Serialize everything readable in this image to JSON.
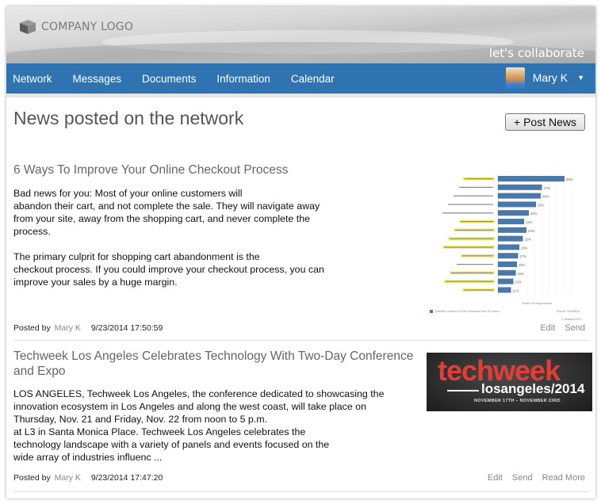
{
  "header": {
    "logo_text": "COMPANY LOGO",
    "logo_icon": "cube-icon",
    "tagline": "let's collaborate"
  },
  "nav": {
    "items": [
      {
        "label": "Network"
      },
      {
        "label": "Messages"
      },
      {
        "label": "Documents"
      },
      {
        "label": "Information"
      },
      {
        "label": "Calendar"
      }
    ],
    "user": {
      "name": "Mary K",
      "avatar": "user-avatar",
      "menu_icon": "caret-down-icon"
    }
  },
  "main": {
    "title": "News posted on the network",
    "post_button": "+ Post News",
    "articles": [
      {
        "title": "6 Ways To Improve Your Online Checkout Process",
        "body": "Bad news for you:  Most of your online customers will\nabandon their cart, and not complete the sale. They will navigate away\nfrom your site, away from the shopping cart, and never complete the\nprocess.\n\nThe primary culprit for shopping cart abandonment is the\ncheckout process. If you could improve your checkout process, you can\nimprove your sales by a huge margin.",
        "posted_by_label": "Posted by",
        "author": "Mary K",
        "date": "9/23/2014 17:50:59",
        "actions": [
          "Edit",
          "Send"
        ],
        "image": "shopping-cart-abandonment-chart"
      },
      {
        "title": "Techweek Los Angeles Celebrates Technology With Two-Day Conference and Expo",
        "body": "LOS ANGELES, Techweek Los Angeles, the conference dedicated to showcasing the\ninnovation ecosystem in Los Angeles and along the west coast, will take place on\nThursday, Nov. 21 and Friday, Nov. 22 from noon to 5 p.m.\nat L3 in Santa Monica Place.  Techweek Los Angeles celebrates the\ntechnology landscape with a variety of panels and events focused on the\nwide array of industries influenc ...",
        "posted_by_label": "Posted by",
        "author": "Mary K",
        "date": "9/23/2014 17:47:20",
        "actions": [
          "Edit",
          "Send",
          "Read More"
        ],
        "image": {
          "brand": "techweek",
          "city": "losangeles/2014",
          "dates": "NOVEMBER 17TH – NOVEMBER 23RD"
        }
      }
    ]
  },
  "chart_data": {
    "type": "bar",
    "orientation": "horizontal",
    "title": "",
    "xlabel": "Share of respondents",
    "categories": [
      "r1",
      "r2",
      "r3",
      "r4",
      "r5",
      "r6",
      "r7",
      "r8",
      "r9",
      "r10",
      "r11",
      "r12",
      "r13",
      "r14"
    ],
    "values": [
      56,
      37,
      36,
      32,
      26,
      22,
      24,
      21,
      18,
      17,
      16,
      15,
      13,
      11
    ],
    "unit": "%",
    "highlighted": [
      true,
      false,
      false,
      false,
      false,
      true,
      true,
      true,
      true,
      true,
      false,
      true,
      true,
      true
    ],
    "colors": {
      "bar": "#4a78a8",
      "highlight": "#f5ec6a"
    },
    "source": "Source: WorldPay",
    "copyright": "© Statista 2013",
    "note": "Selected countries; 10,000 consumers and 102 senior retail decision makers; January and February 2012"
  }
}
